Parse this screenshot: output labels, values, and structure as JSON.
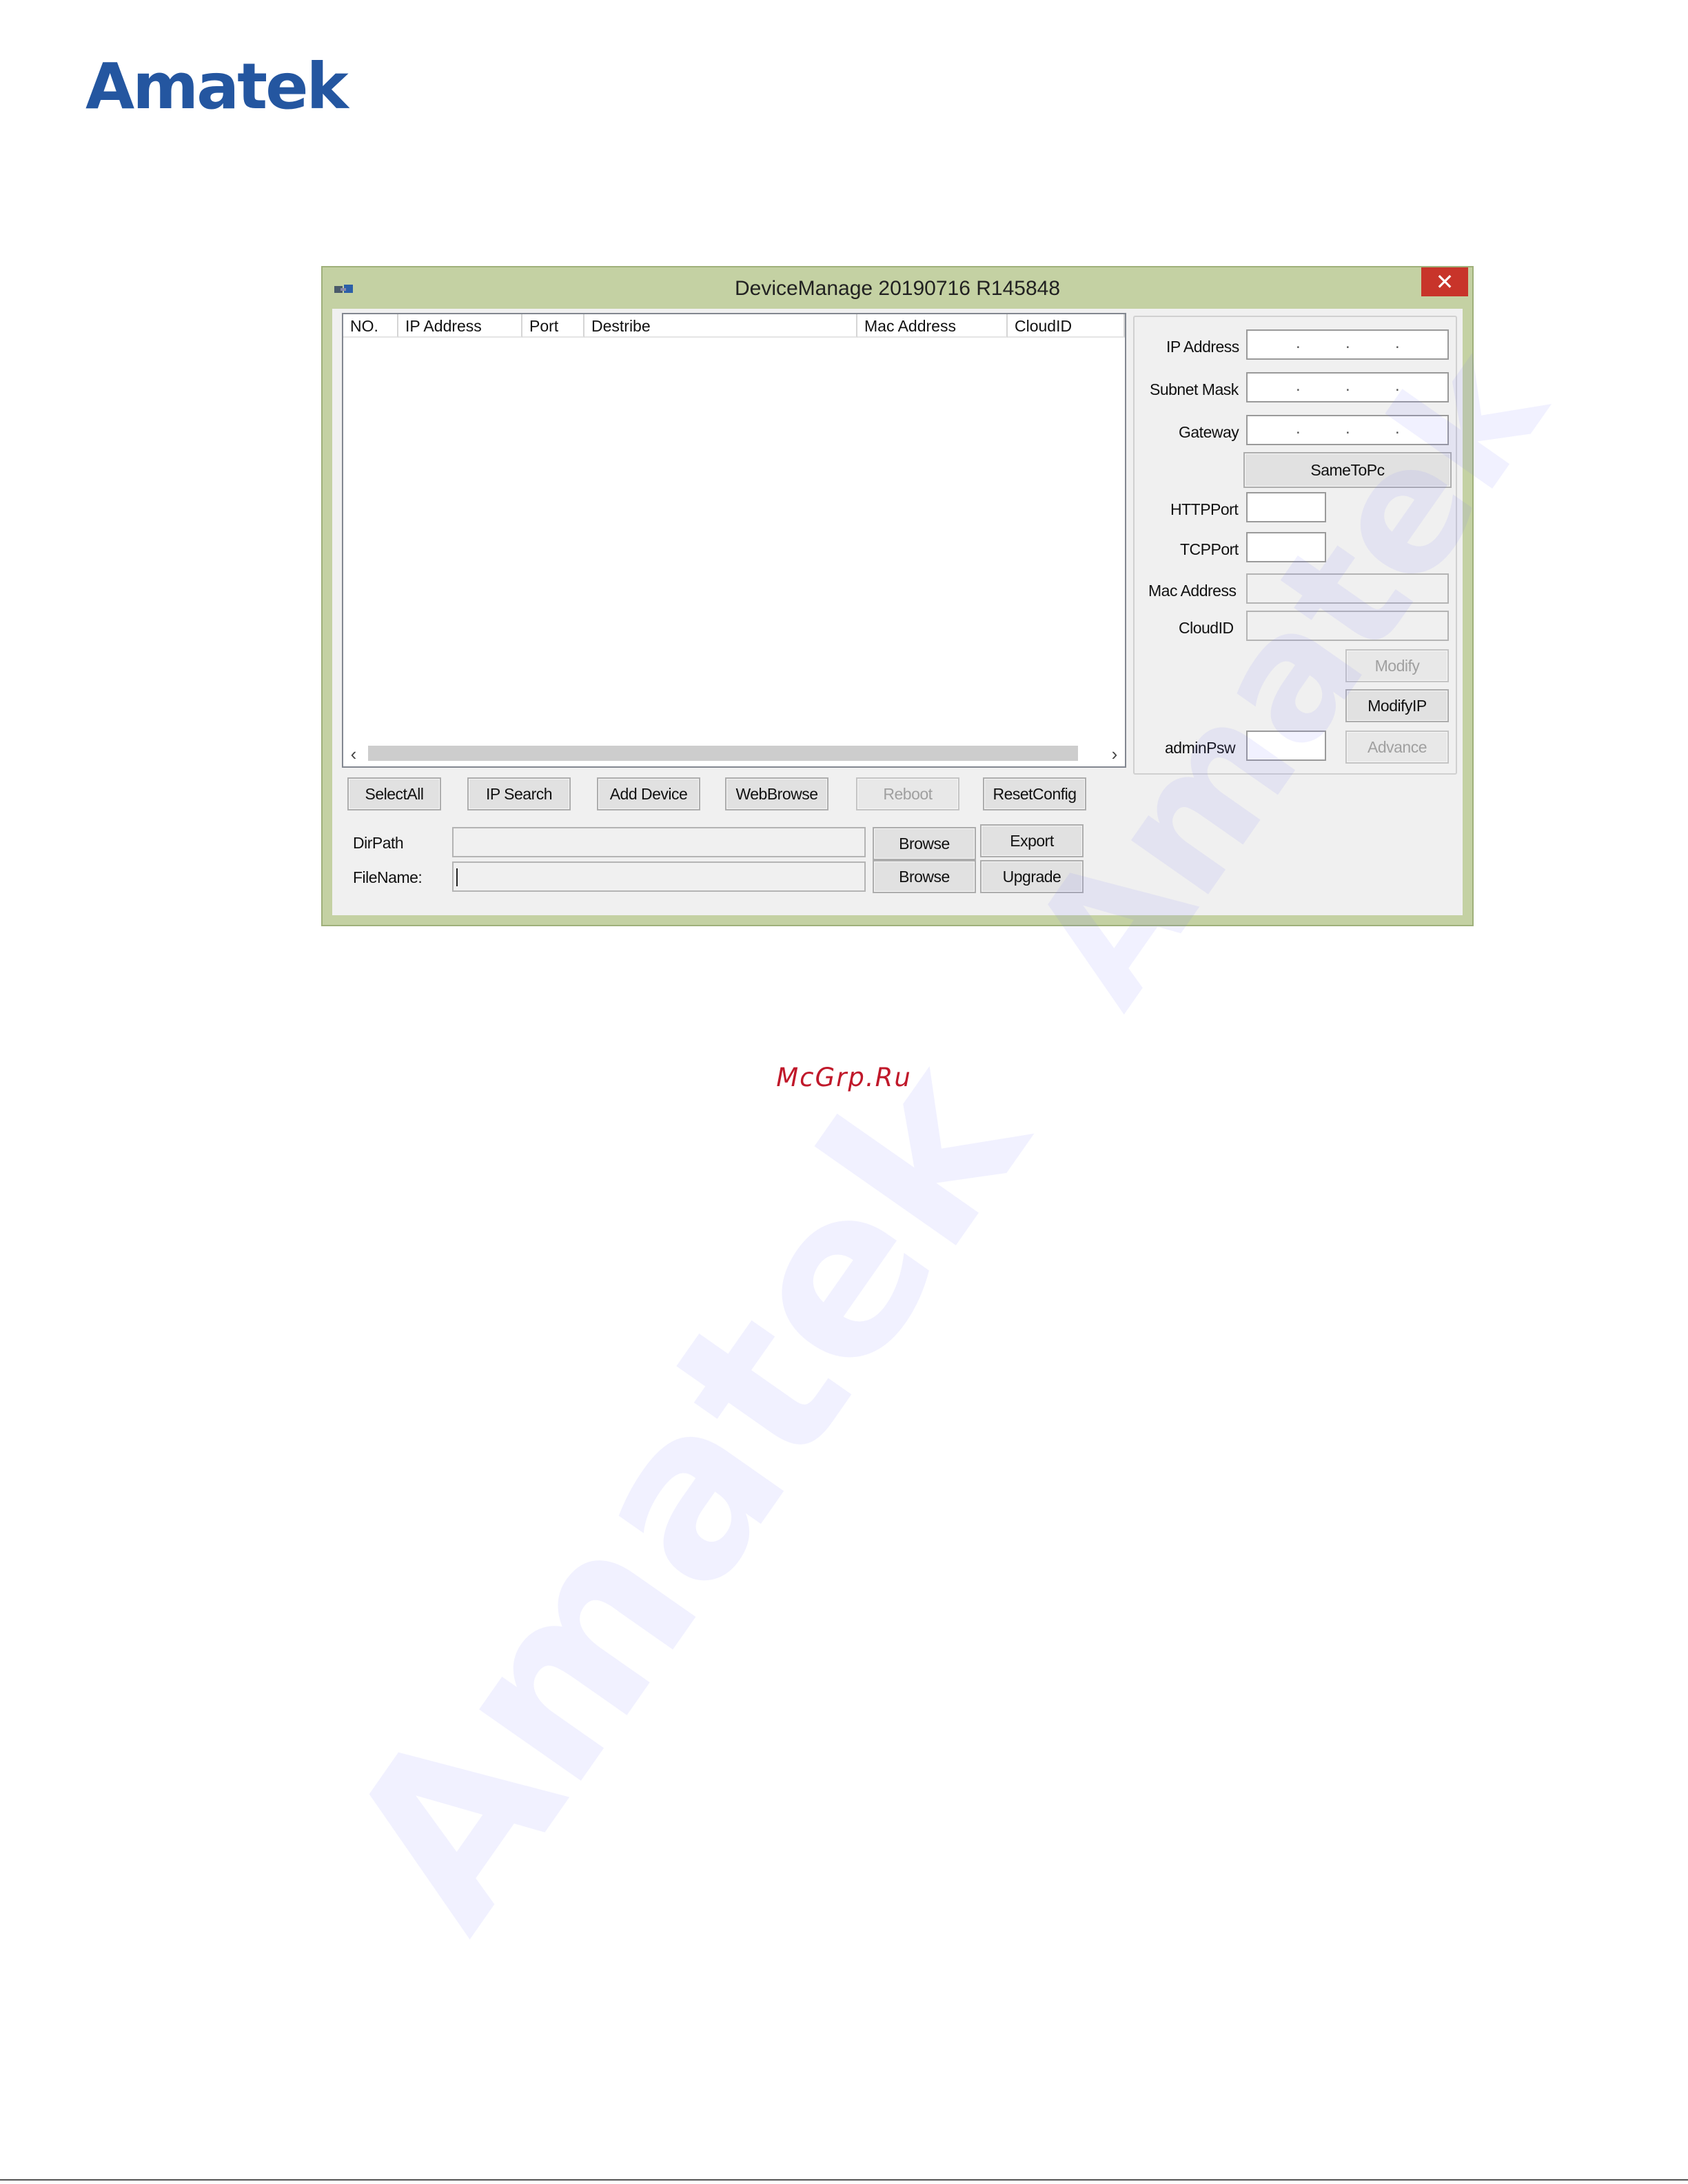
{
  "header": {
    "logo_text": "Amatek"
  },
  "watermark": {
    "text": "Amatek"
  },
  "window": {
    "title": "DeviceManage 20190716 R145848",
    "close_glyph": "✕",
    "colors": {
      "titlebar": "#c4d1a3",
      "close": "#c8342a"
    }
  },
  "table": {
    "columns": [
      "NO.",
      "IP Address",
      "Port",
      "Destribe",
      "Mac Address",
      "CloudID"
    ],
    "rows": [],
    "scroll_left": "‹",
    "scroll_right": "›"
  },
  "toolbar": {
    "select_all": "SelectAll",
    "ip_search": "IP Search",
    "add_device": "Add Device",
    "web_browse": "WebBrowse",
    "reboot": "Reboot",
    "reset_config": "ResetConfig"
  },
  "files": {
    "dirpath_label": "DirPath",
    "filename_label": "FileName:",
    "dirpath_value": "",
    "filename_value": "",
    "browse_label": "Browse",
    "export_label": "Export",
    "upgrade_label": "Upgrade"
  },
  "settings": {
    "ip_address_label": "IP Address",
    "subnet_mask_label": "Subnet Mask",
    "gateway_label": "Gateway",
    "ip_dot": ".",
    "same_to_pc_label": "SameToPc",
    "http_port_label": "HTTPPort",
    "tcp_port_label": "TCPPort",
    "mac_address_label": "Mac Address",
    "cloud_id_label": "CloudID",
    "http_port_value": "",
    "tcp_port_value": "",
    "mac_address_value": "",
    "cloud_id_value": "",
    "modify_label": "Modify",
    "modify_ip_label": "ModifyIP",
    "admin_psw_label": "adminPsw",
    "admin_psw_value": "",
    "advance_label": "Advance"
  },
  "footer": {
    "site": "McGrp.Ru"
  }
}
